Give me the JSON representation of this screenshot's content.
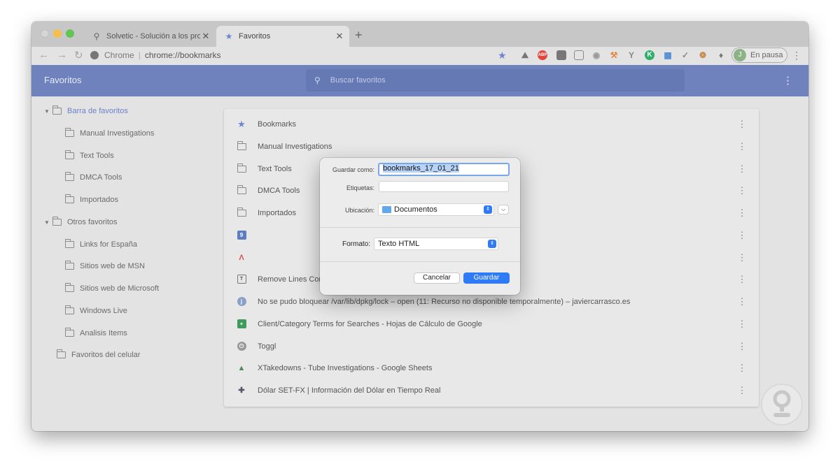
{
  "browser": {
    "tabs": [
      {
        "title": "Solvetic - Solución a los problem",
        "icon": "search-globe-icon"
      },
      {
        "title": "Favoritos",
        "icon": "star-icon"
      }
    ],
    "address": {
      "site": "Chrome",
      "url": "chrome://bookmarks"
    },
    "profile": {
      "initial": "J",
      "status": "En pausa"
    }
  },
  "header": {
    "title": "Favoritos",
    "search_placeholder": "Buscar favoritos"
  },
  "sidebar": {
    "items": [
      {
        "label": "Barra de favoritos",
        "selected": true,
        "expanded": true
      },
      {
        "label": "Manual Investigations"
      },
      {
        "label": "Text Tools"
      },
      {
        "label": "DMCA Tools"
      },
      {
        "label": "Importados"
      },
      {
        "label": "Otros favoritos",
        "expanded": true
      },
      {
        "label": "Links for España"
      },
      {
        "label": "Sitios web de MSN"
      },
      {
        "label": "Sitios web de Microsoft"
      },
      {
        "label": "Windows Live"
      },
      {
        "label": "Analisis Items"
      },
      {
        "label": "Favoritos del celular"
      }
    ]
  },
  "list": {
    "rows": [
      {
        "label": "Bookmarks",
        "icon": "star-icon"
      },
      {
        "label": "Manual Investigations",
        "icon": "folder-icon"
      },
      {
        "label": "Text Tools",
        "icon": "folder-icon"
      },
      {
        "label": "DMCA Tools",
        "icon": "folder-icon"
      },
      {
        "label": "Importados",
        "icon": "folder-icon"
      },
      {
        "label": "",
        "icon": "calendar-favicon"
      },
      {
        "label": "",
        "icon": "red-logo-favicon"
      },
      {
        "label": "Remove Lines Cont",
        "icon": "text-tool-favicon"
      },
      {
        "label": "No se pudo bloquear /var/lib/dpkg/lock – open (11: Recurso no disponible temporalmente) – javiercarrasco.es",
        "icon": "site-favicon"
      },
      {
        "label": "Client/Category Terms for Searches - Hojas de Cálculo de Google",
        "icon": "sheets-favicon"
      },
      {
        "label": "Toggl",
        "icon": "power-favicon"
      },
      {
        "label": "XTakedowns - Tube Investigations - Google Sheets",
        "icon": "drive-favicon"
      },
      {
        "label": "Dólar SET-FX | Información del Dólar en Tiempo Real",
        "icon": "dollar-favicon"
      }
    ]
  },
  "dialog": {
    "save_as_label": "Guardar como:",
    "save_as_value": "bookmarks_17_01_21",
    "tags_label": "Etiquetas:",
    "tags_value": "",
    "location_label": "Ubicación:",
    "location_value": "Documentos",
    "format_label": "Formato:",
    "format_value": "Texto HTML",
    "cancel_label": "Cancelar",
    "save_label": "Guardar"
  },
  "colors": {
    "accent": "#2f7bf5",
    "header": "#6f82be",
    "selected": "#6b82cb"
  }
}
